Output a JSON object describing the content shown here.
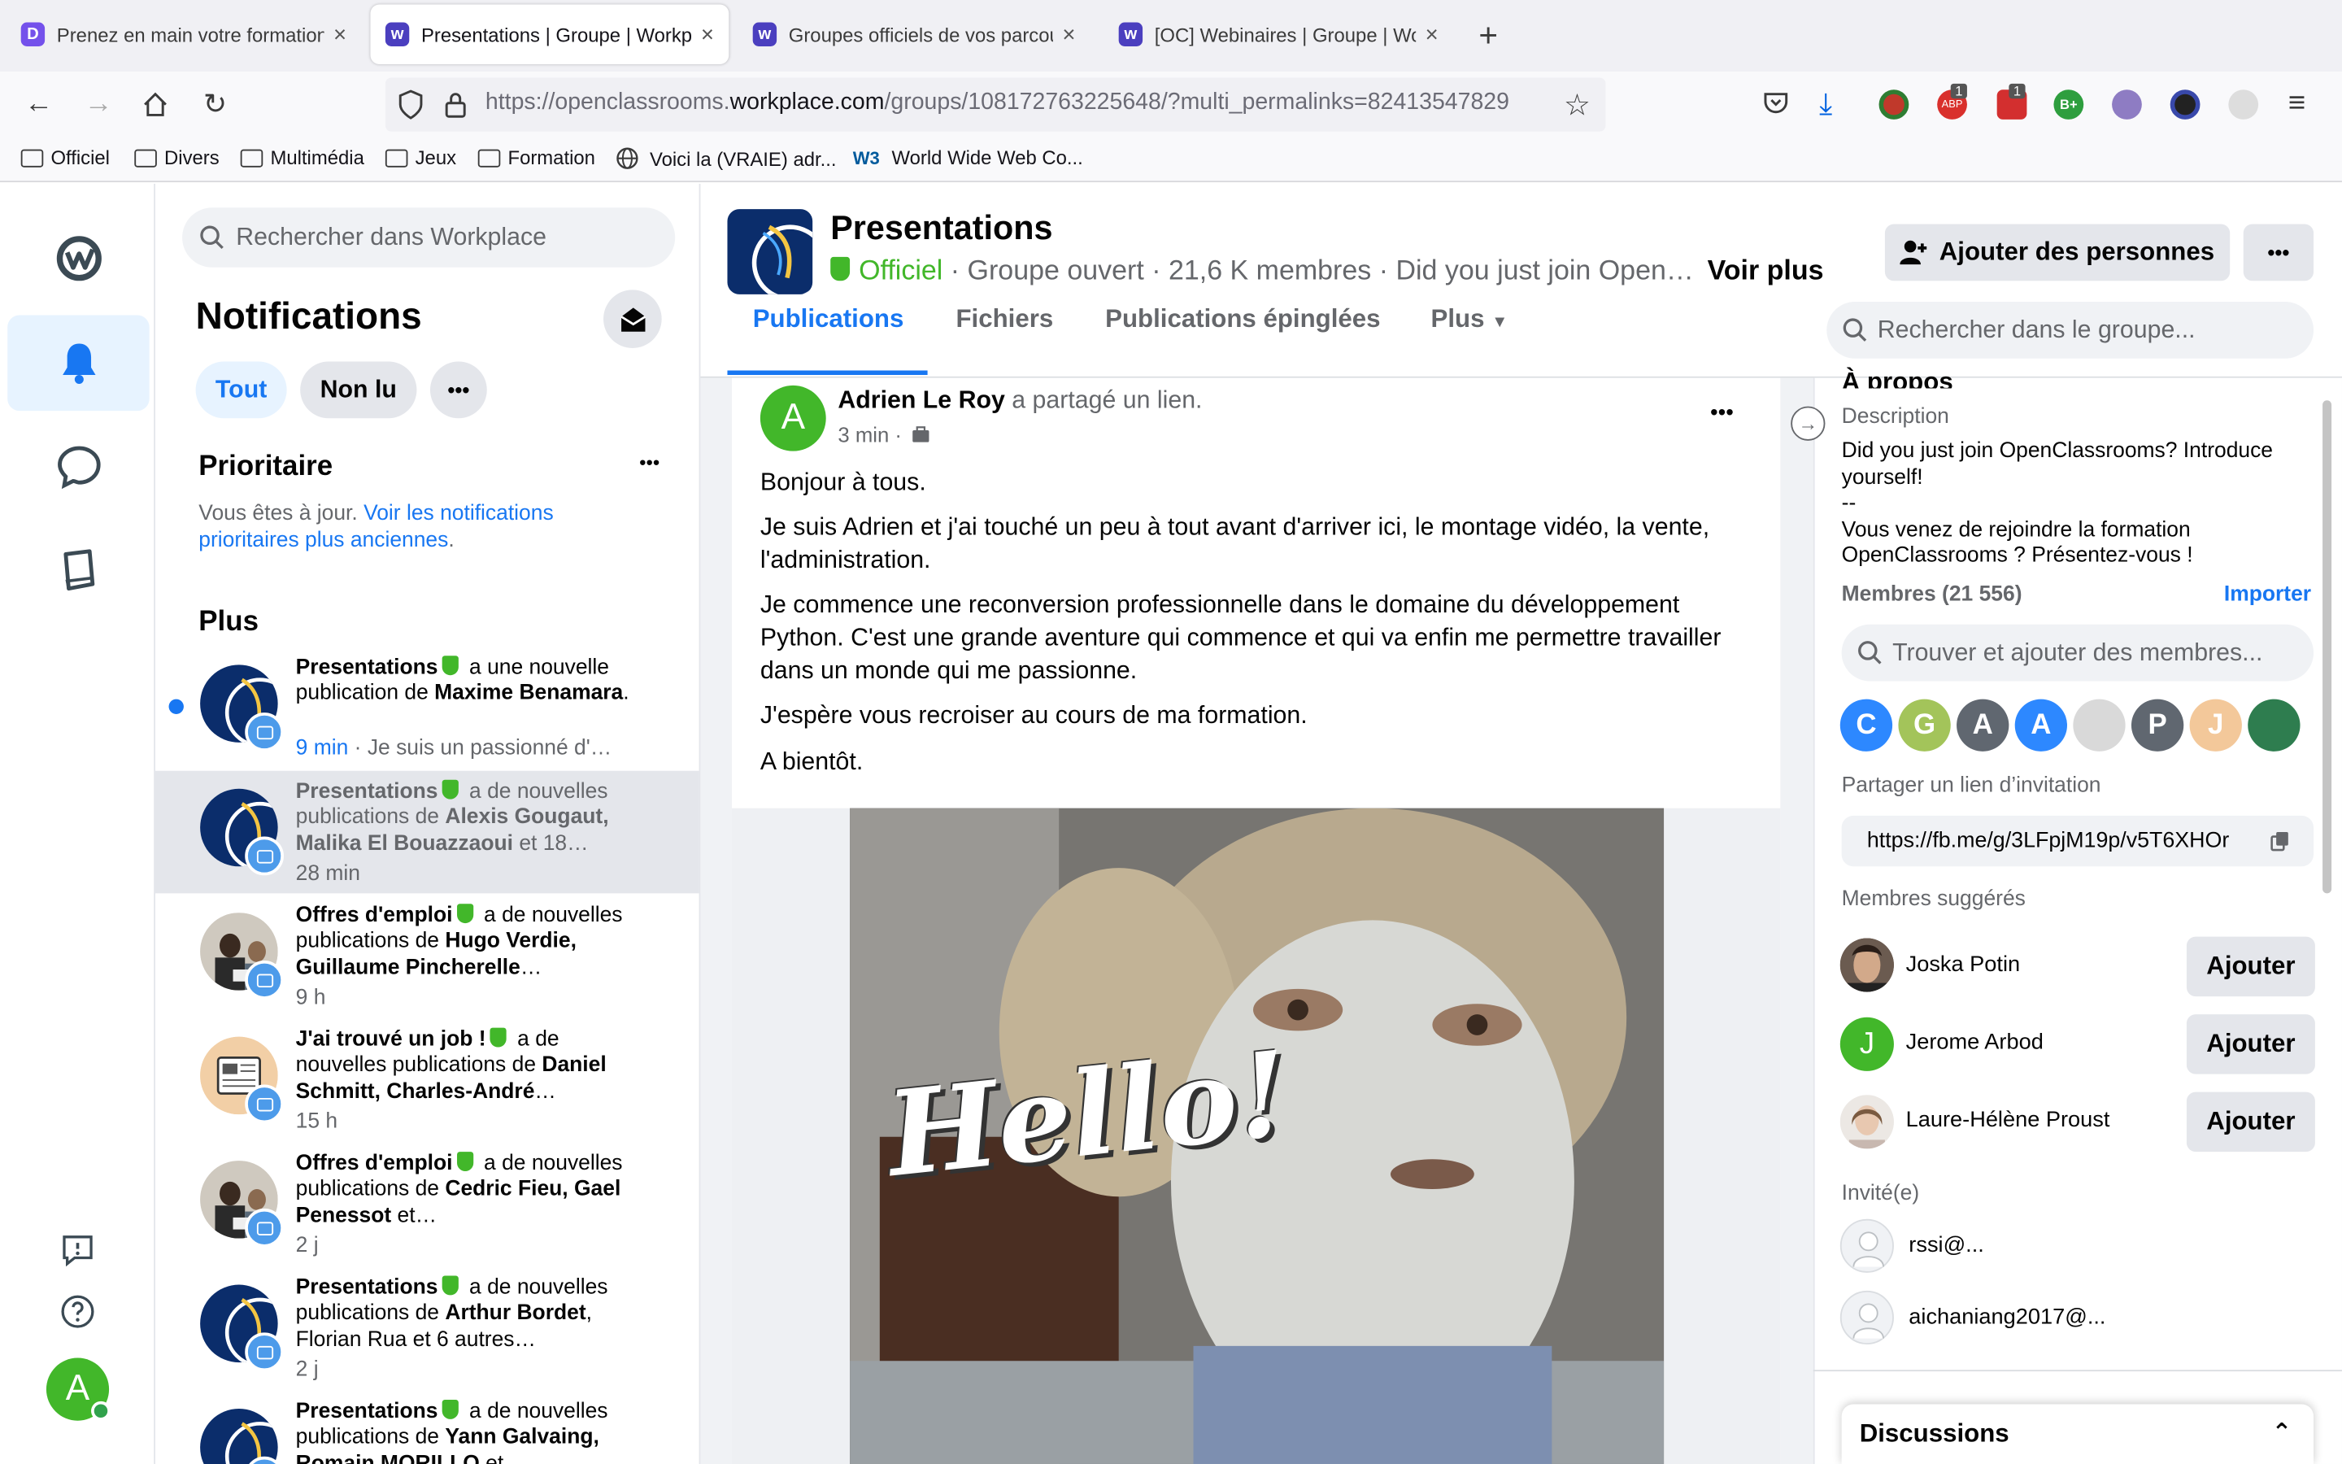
{
  "browser": {
    "tabs": [
      {
        "title": "Prenez en main votre formation -",
        "active": false
      },
      {
        "title": "Presentations | Groupe | Workpla",
        "active": true
      },
      {
        "title": "Groupes officiels de vos parcour",
        "active": false
      },
      {
        "title": "[OC] Webinaires | Groupe | Work",
        "active": false
      }
    ],
    "close_glyph": "×",
    "new_tab_glyph": "+",
    "url_prefix": "https://openclassrooms.",
    "url_domain": "workplace.com",
    "url_rest": "/groups/108172763225648/?multi_permalinks=82413547829",
    "bookmarks": [
      "Officiel",
      "Divers",
      "Multimédia",
      "Jeux",
      "Formation",
      "Voici la (VRAIE) adr...",
      "World Wide Web Co..."
    ],
    "w3_logo": "W3",
    "ext_badges": [
      "1",
      "1"
    ],
    "ext_labels": [
      "ABP",
      "B+"
    ]
  },
  "sidebar": {
    "search_placeholder": "Rechercher dans Workplace",
    "title": "Notifications",
    "filters": [
      "Tout",
      "Non lu"
    ],
    "more": "•••",
    "prioritaire_title": "Prioritaire",
    "prioritaire_text": "Vous êtes à jour.",
    "prioritaire_link": "Voir les notifications prioritaires plus anciennes",
    "prioritaire_dot": ".",
    "plus_title": "Plus",
    "items": [
      {
        "group": "Presentations",
        "mid": " a une nouvelle publication de ",
        "names": "Maxime Benamara",
        "tail": ".",
        "time": "9 min",
        "excerpt": " · Je suis un passionné d'…",
        "unread": true,
        "avatar": "presentations"
      },
      {
        "group": "Presentations",
        "mid": " a de nouvelles publications de ",
        "names": "Alexis Gougaut, Malika El Bouazzaoui",
        "tail": " et 18…",
        "time": "28 min",
        "excerpt": "",
        "unread": false,
        "avatar": "presentations"
      },
      {
        "group": "Offres d'emploi",
        "mid": " a de nouvelles publications de ",
        "names": "Hugo Verdie, Guillaume Pincherelle",
        "tail": "…",
        "time": "9 h",
        "excerpt": "",
        "unread": false,
        "avatar": "office"
      },
      {
        "group": "J'ai trouvé un job !",
        "mid": " a de nouvelles publications de ",
        "names": "Daniel Schmitt, Charles-André",
        "tail": "…",
        "time": "15 h",
        "excerpt": "",
        "unread": false,
        "avatar": "news"
      },
      {
        "group": "Offres d'emploi",
        "mid": " a de nouvelles publications de ",
        "names": "Cedric Fieu, Gael Penessot",
        "tail": " et…",
        "time": "2 j",
        "excerpt": "",
        "unread": false,
        "avatar": "office"
      },
      {
        "group": "Presentations",
        "mid": " a de nouvelles publications de ",
        "names": "Arthur Bordet",
        "tail": ", Florian Rua et 6 autres…",
        "time": "2 j",
        "excerpt": "",
        "unread": false,
        "avatar": "presentations"
      },
      {
        "group": "Presentations",
        "mid": " a de nouvelles publications de ",
        "names": "Yann Galvaing, Romain MORILLO",
        "tail": " et…",
        "time": "",
        "excerpt": "",
        "unread": false,
        "avatar": "presentations"
      }
    ]
  },
  "group": {
    "name": "Presentations",
    "official": "Officiel",
    "meta": " · Groupe ouvert · 21,6 K membres · Did you just join Open…",
    "see_more": "Voir plus",
    "add_people": "Ajouter des personnes",
    "more": "•••",
    "tabs": [
      "Publications",
      "Fichiers",
      "Publications épinglées",
      "Plus"
    ],
    "search_placeholder": "Rechercher dans le groupe..."
  },
  "post": {
    "avatar_letter": "A",
    "author": "Adrien Le Roy",
    "action": " a partagé un lien.",
    "time": "3 min ·",
    "more": "•••",
    "paragraphs": [
      "Bonjour à tous.",
      "Je suis Adrien et j'ai touché un peu à tout avant d'arriver ici, le montage vidéo, la vente, l'administration.",
      "Je commence une reconversion professionnelle dans le domaine du développement Python. C'est une grande aventure qui commence et qui va enfin me permettre travailler dans un monde qui me passionne.",
      "J'espère vous recroiser au cours de ma formation.",
      "A bientôt."
    ],
    "gif_caption": "Hello!"
  },
  "about": {
    "heading": "À propos",
    "description_label": "Description",
    "description": "Did you just join OpenClassrooms? Introduce yourself!",
    "description_sep": "--",
    "description_fr": "Vous venez de rejoindre la formation OpenClassrooms ? Présentez-vous !",
    "members_label": "Membres (21 556)",
    "import": "Importer",
    "find_members_placeholder": "Trouver et ajouter des membres...",
    "member_avatars": [
      {
        "letter": "C",
        "color": "#2d88ff"
      },
      {
        "letter": "G",
        "color": "#a3c45a"
      },
      {
        "letter": "A",
        "color": "#606770"
      },
      {
        "letter": "A",
        "color": "#2d88ff"
      },
      {
        "letter": "",
        "color": "#d9d9d9"
      },
      {
        "letter": "P",
        "color": "#606770"
      },
      {
        "letter": "J",
        "color": "#f3c89a"
      },
      {
        "letter": "",
        "color": "#2e7d4f"
      }
    ],
    "invite_label": "Partager un lien d’invitation",
    "invite_link": "https://fb.me/g/3LFpjM19p/v5T6XHOr",
    "suggested_label": "Membres suggérés",
    "suggested": [
      {
        "name": "Joska Potin",
        "button": "Ajouter",
        "avatar_letter": ""
      },
      {
        "name": "Jerome Arbod",
        "button": "Ajouter",
        "avatar_letter": "J"
      },
      {
        "name": "Laure-Hélène Proust",
        "button": "Ajouter",
        "avatar_letter": ""
      }
    ],
    "invited_label": "Invité(e)",
    "invited": [
      "rssi@...",
      "aichaniang2017@..."
    ],
    "discussions": "Discussions"
  },
  "colors": {
    "accent": "#1877f2",
    "official_green": "#42b72a",
    "notif_blue": "#4d9bea"
  }
}
